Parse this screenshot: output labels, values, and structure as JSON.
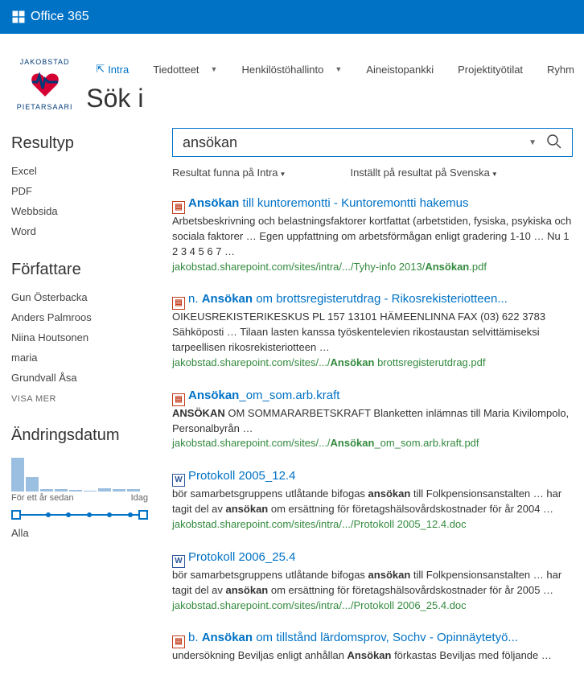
{
  "topbar": {
    "product": "Office 365"
  },
  "brand": {
    "top": "JAKOBSTAD",
    "bottom": "PIETARSAARI"
  },
  "nav": {
    "items": [
      {
        "label": "Intra",
        "active": true,
        "icon": true
      },
      {
        "label": "Tiedotteet",
        "dropdown": true
      },
      {
        "label": "Henkilöstöhallinto",
        "dropdown": true
      },
      {
        "label": "Aineistopankki"
      },
      {
        "label": "Projektityötilat"
      },
      {
        "label": "Ryhm"
      }
    ]
  },
  "searchTitle": "Sök i",
  "sidebar": {
    "resultType": {
      "heading": "Resultyp",
      "items": [
        "Excel",
        "PDF",
        "Webbsida",
        "Word"
      ]
    },
    "author": {
      "heading": "Författare",
      "items": [
        "Gun Österbacka",
        "Anders Palmroos",
        "Niina Houtsonen",
        "maria",
        "Grundvall Åsa"
      ],
      "more": "VISA MER"
    },
    "date": {
      "heading": "Ändringsdatum",
      "leftLabel": "För ett år sedan",
      "rightLabel": "Idag",
      "all": "Alla",
      "bars": [
        42,
        18,
        3,
        3,
        2,
        1,
        4,
        3,
        3
      ]
    }
  },
  "search": {
    "query": "ansökan",
    "filterLeft": "Resultat funna på Intra",
    "filterRight": "Inställt på resultat på Svenska"
  },
  "results": [
    {
      "icon": "pdf",
      "titlePre": "",
      "titleBold": "Ansökan",
      "titlePost": " till kuntoremontti - Kuntoremontti hakemus",
      "snippet": "Arbetsbeskrivning och belastningsfaktorer kortfattat (arbetstiden, fysiska, psykiska och sociala faktorer … Egen uppfattning om arbetsförmågan enligt gradering 1-10 … Nu 1 2 3 4 5 6 7 …",
      "urlPre": "jakobstad.sharepoint.com/sites/intra/.../Tyhy-info 2013/",
      "urlBold": "Ansökan",
      "urlPost": ".pdf"
    },
    {
      "icon": "pdf",
      "titlePre": "n. ",
      "titleBold": "Ansökan",
      "titlePost": " om brottsregisterutdrag - Rikosrekisteriotteen...",
      "snippet": "OIKEUSREKISTERIKESKUS PL 157 13101 HÄMEENLINNA FAX (03) 622 3783 Sähköposti … Tilaan lasten kanssa työskentelevien rikostaustan selvittämiseksi tarpeellisen rikosrekisteriotteen …",
      "urlPre": "jakobstad.sharepoint.com/sites/.../",
      "urlBold": "Ansökan",
      "urlPost": " brottsregisterutdrag.pdf"
    },
    {
      "icon": "pdf",
      "titlePre": "",
      "titleBold": "Ansökan",
      "titlePost": "_om_som.arb.kraft",
      "snippet": "<b>ANSÖKAN</b> OM SOMMARARBETSKRAFT Blanketten inlämnas till Maria Kivilompolo, Personalbyrån …",
      "urlPre": "jakobstad.sharepoint.com/sites/.../",
      "urlBold": "Ansökan",
      "urlPost": "_om_som.arb.kraft.pdf"
    },
    {
      "icon": "doc",
      "titlePre": "",
      "titleBold": "",
      "titlePost": "Protokoll 2005_12.4",
      "snippet": "bör samarbetsgruppens utlåtande bifogas <b>ansökan</b> till Folkpensionsanstalten … har tagit del av <b>ansökan</b> om ersättning för företagshälsovårdskostnader för år 2004 …",
      "urlPre": "jakobstad.sharepoint.com/sites/intra/.../Protokoll 2005_12.4.doc",
      "urlBold": "",
      "urlPost": ""
    },
    {
      "icon": "doc",
      "titlePre": "",
      "titleBold": "",
      "titlePost": "Protokoll 2006_25.4",
      "snippet": "bör samarbetsgruppens utlåtande bifogas <b>ansökan</b> till Folkpensionsanstalten … har tagit del av <b>ansökan</b> om ersättning för företagshälsovårdskostnader för år 2005 …",
      "urlPre": "jakobstad.sharepoint.com/sites/intra/.../Protokoll 2006_25.4.doc",
      "urlBold": "",
      "urlPost": ""
    },
    {
      "icon": "pdf",
      "titlePre": "b. ",
      "titleBold": "Ansökan",
      "titlePost": " om tillstånd lärdomsprov, Sochv - Opinnäytetyö...",
      "snippet": "undersökning Beviljas enligt anhållan    <b>Ansökan</b> förkastas    Beviljas med följande …",
      "urlPre": "",
      "urlBold": "",
      "urlPost": ""
    }
  ]
}
